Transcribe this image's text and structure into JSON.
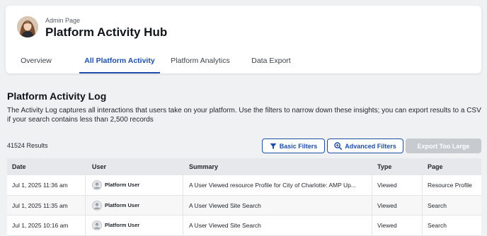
{
  "header": {
    "eyebrow": "Admin Page",
    "title": "Platform Activity Hub",
    "avatar_icon": "user-photo-avatar"
  },
  "tabs": [
    {
      "label": "Overview",
      "active": false
    },
    {
      "label": "All Platform Activity",
      "active": true
    },
    {
      "label": "Platform Analytics",
      "active": false
    },
    {
      "label": "Data Export",
      "active": false
    }
  ],
  "log": {
    "title": "Platform Activity Log",
    "description": "The Activity Log captures all interactions that users take on your platform. Use the filters to narrow down these insights; you can export results to a CSV if your search contains less than 2,500 records",
    "results": "41524 Results"
  },
  "toolbar": {
    "basic_filters": "Basic Filters",
    "advanced_filters": "Advanced Filters",
    "export": "Export Too Large",
    "accent_color": "#1d4fa8",
    "disabled_color": "#c7cacf"
  },
  "table": {
    "headers": {
      "date": "Date",
      "user": "User",
      "summary": "Summary",
      "type": "Type",
      "page": "Page"
    },
    "rows": [
      {
        "date": "Jul 1, 2025 11:36 am",
        "user": "Platform User",
        "summary": "A User  Viewed resource Profile for City of Charlotte: AMP Up...",
        "type": "Viewed",
        "page": "Resource Profile"
      },
      {
        "date": "Jul 1, 2025 11:35 am",
        "user": "Platform User",
        "summary": "A User  Viewed  Site Search",
        "type": "Viewed",
        "page": "Search"
      },
      {
        "date": "Jul 1, 2025 10:16 am",
        "user": "Platform User",
        "summary": "A User  Viewed  Site Search",
        "type": "Viewed",
        "page": "Search"
      }
    ]
  }
}
